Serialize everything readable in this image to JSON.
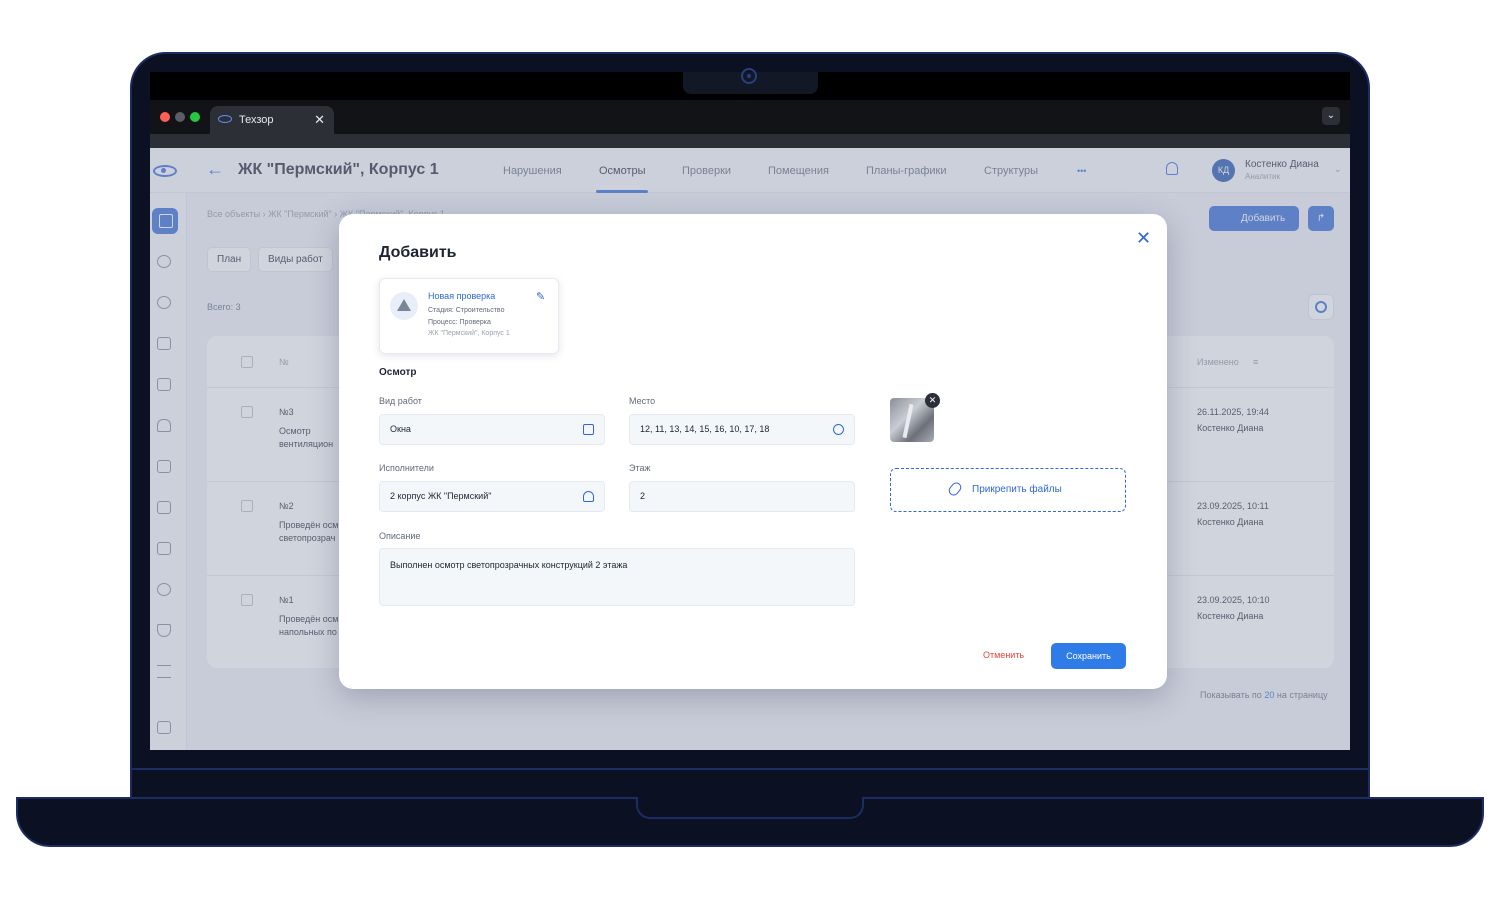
{
  "browser": {
    "tab_title": "Техзор",
    "tab_close": "✕",
    "menu_chevron": "⌄"
  },
  "header": {
    "back_icon": "←",
    "title": "ЖК \"Пермский\", Корпус 1",
    "nav": [
      "Нарушения",
      "Осмотры",
      "Проверки",
      "Помещения",
      "Планы-графики",
      "Структуры"
    ],
    "more": "•••",
    "active_tab": "Осмотры"
  },
  "user": {
    "initials": "КД",
    "name": "Костенко Диана",
    "role": "Аналитик",
    "chevron": "⌄"
  },
  "page": {
    "breadcrumbs": "Все объекты   ›   ЖК \"Пермский\"   ›   ЖК \"Пермский\", Корпус 1",
    "add_button": "Добавить",
    "filters": [
      "План",
      "Виды работ"
    ],
    "total": "Всего: 3",
    "table_headers": {
      "number": "№",
      "changed": "Изменено"
    },
    "rows": [
      {
        "number": "№3",
        "title": "Осмотр",
        "title2": "вентиляцион",
        "date": "26.11.2025, 19:44",
        "author": "Костенко Диана"
      },
      {
        "number": "№2",
        "title": "Проведён осм",
        "title2": "светопрозрач",
        "date": "23.09.2025, 10:11",
        "author": "Костенко Диана"
      },
      {
        "number": "№1",
        "title": "Проведён осм",
        "title2": "напольных по",
        "date": "23.09.2025, 10:10",
        "author": "Костенко Диана"
      }
    ],
    "pagination_prefix": "Показывать по",
    "pagination_value": "20",
    "pagination_suffix": "на страницу"
  },
  "modal": {
    "title": "Добавить",
    "close": "✕",
    "card": {
      "name": "Новая проверка",
      "stage": "Стадия: Строительство",
      "process": "Процесс: Проверка",
      "object": "ЖК \"Пермский\", Корпус 1"
    },
    "section": "Осмотр",
    "fields": {
      "work_type_label": "Вид работ",
      "work_type_value": "Окна",
      "place_label": "Место",
      "place_value": "12, 11, 13, 14, 15, 16, 10, 17, 18",
      "performers_label": "Исполнители",
      "performers_value": "2 корпус ЖК \"Пермский\"",
      "floor_label": "Этаж",
      "floor_value": "2",
      "description_label": "Описание",
      "description_value": "Выполнен осмотр светопрозрачных конструкций 2 этажа"
    },
    "attach_label": "Прикрепить файлы",
    "thumb_remove": "✕",
    "cancel": "Отменить",
    "save": "Сохранить"
  },
  "colors": {
    "accent": "#2f67d8",
    "danger": "#e0473a",
    "laptop": "#0b1122"
  }
}
